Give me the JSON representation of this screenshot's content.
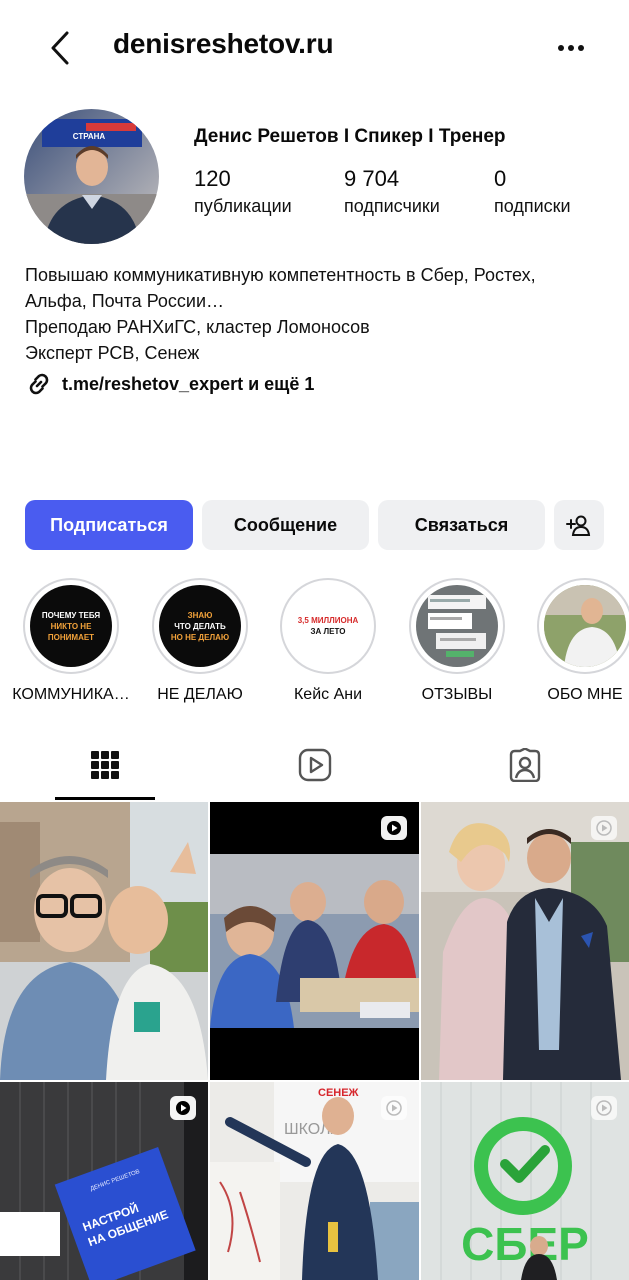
{
  "header": {
    "username": "denisreshetov.ru",
    "back_icon": "chevron-left-icon",
    "more_icon": "more-horizontal-icon"
  },
  "profile": {
    "display_name": "Денис Решетов I Спикер I Тренер",
    "stats": [
      {
        "value": "120",
        "label": "публикации"
      },
      {
        "value": "9 704",
        "label": "подписчики"
      },
      {
        "value": "0",
        "label": "подписки"
      }
    ],
    "bio_lines": [
      "Повышаю коммуникативную компетентность в Сбер, Ростех,",
      "Альфа, Почта России…",
      "Преподаю РАНХиГС, кластер Ломоносов",
      "Эксперт РСВ, Сенеж"
    ],
    "link_text": "t.me/reshetov_expert и ещё 1",
    "avatar_banner_text": "СТРАНА ВОЗМОЖНОСТЕЙ"
  },
  "actions": {
    "follow": "Подписаться",
    "message": "Сообщение",
    "contact": "Связаться",
    "add_user_icon": "add-user-icon"
  },
  "highlights": [
    {
      "label": "КОММУНИКА…",
      "cover_line1": "ПОЧЕМУ ТЕБЯ",
      "cover_line2": "НИКТО НЕ ПОНИМАЕТ"
    },
    {
      "label": "НЕ ДЕЛАЮ",
      "cover_line1": "ЗНАЮ",
      "cover_line2": "ЧТО ДЕЛАТЬ",
      "cover_line3": "НО НЕ ДЕЛАЮ"
    },
    {
      "label": "Кейс Ани",
      "cover_line1": "3,5 МИЛЛИОНА",
      "cover_line2": "ЗА ЛЕТО"
    },
    {
      "label": "ОТЗЫВЫ"
    },
    {
      "label": "ОБО МНЕ"
    }
  ],
  "tabs": [
    {
      "icon": "grid-icon",
      "active": true
    },
    {
      "icon": "reels-icon",
      "active": false
    },
    {
      "icon": "tagged-icon",
      "active": false
    }
  ],
  "grid_posts": [
    {
      "type": "photo"
    },
    {
      "type": "reel"
    },
    {
      "type": "reel"
    },
    {
      "type": "reel",
      "book_text": "НАСТРОЙ НА ОБЩЕНИЕ",
      "book_author": "ДЕНИС РЕШЕТОВ"
    },
    {
      "type": "reel",
      "sign_text": "ШКОЛА",
      "banner_text": "СЕНЕЖ"
    },
    {
      "type": "reel",
      "sign_text": "СБЕР"
    }
  ],
  "colors": {
    "primary_button": "#4a5cf0",
    "secondary_button": "#eff0f2",
    "sber_green": "#21a038"
  }
}
